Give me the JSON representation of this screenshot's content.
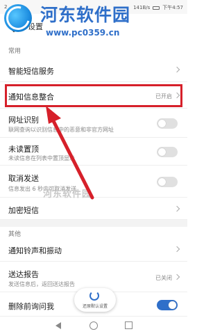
{
  "status_bar": {
    "left": "2",
    "speed": "141B/s",
    "time": "下午4:57"
  },
  "watermark": {
    "site_name": "河东软件园",
    "url": "www.pc0359.cn",
    "mid_text": "河东软件园"
  },
  "app_bar": {
    "title": "设置"
  },
  "sections": {
    "common": "常用",
    "other": "其他"
  },
  "rows": {
    "smart_sms": {
      "title": "智能短信服务"
    },
    "notify_merge": {
      "title": "通知信息整合",
      "value": "已开启"
    },
    "url_detect": {
      "title": "网址识别",
      "sub": "联网查询以识别信息中的恶意和非官方网址",
      "toggle": false
    },
    "unread_top": {
      "title": "未读置顶",
      "sub": "未读信息在列表中置顶显示",
      "toggle": false
    },
    "cancel_send": {
      "title": "取消发送",
      "sub": "信息发出 6 秒内可取消发送",
      "toggle": false
    },
    "encrypt_sms": {
      "title": "加密短信"
    },
    "ringtone": {
      "title": "通知铃声和振动"
    },
    "delivery_report": {
      "title": "送达报告",
      "sub": "发送信息后，返回送达报告",
      "value": "已关闭"
    },
    "delete_confirm": {
      "title": "删除前询问我",
      "toggle": true
    }
  },
  "fab": {
    "label": "还原默认设置"
  },
  "colors": {
    "highlight": "#d6202a",
    "accent": "#2f6fc9"
  },
  "icons": [
    "back-arrow-icon",
    "chevron-right-icon",
    "restore-icon",
    "nav-back-icon",
    "nav-home-icon",
    "nav-recent-icon"
  ]
}
